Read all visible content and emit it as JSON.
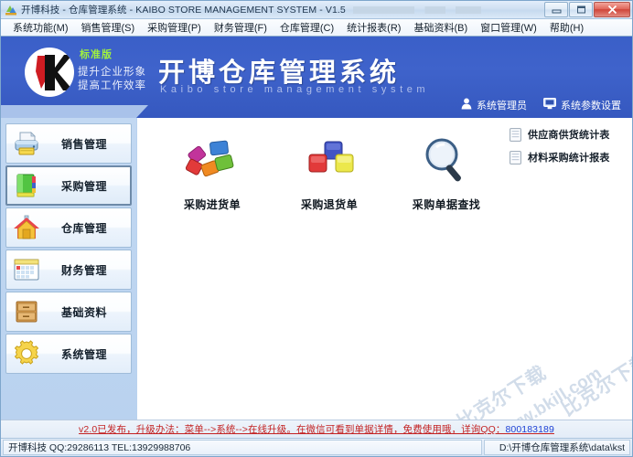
{
  "window": {
    "title": "开博科技 - 仓库管理系统 - KAIBO STORE MANAGEMENT SYSTEM - V1.5",
    "app_icon": "app-icon",
    "controls": {
      "minimize": "—",
      "maximize": "❐",
      "close": "✕"
    }
  },
  "menubar": {
    "items": [
      {
        "label": "系统功能(M)"
      },
      {
        "label": "销售管理(S)"
      },
      {
        "label": "采购管理(P)"
      },
      {
        "label": "财务管理(F)"
      },
      {
        "label": "仓库管理(C)"
      },
      {
        "label": "统计报表(R)"
      },
      {
        "label": "基础资料(B)"
      },
      {
        "label": "窗口管理(W)"
      },
      {
        "label": "帮助(H)"
      }
    ]
  },
  "banner": {
    "edition_badge": "标准版",
    "slogan_line1": "提升企业形象",
    "slogan_line2": "提高工作效率",
    "brand_cn": "开博仓库管理系统",
    "brand_en": "Kaibo store management system",
    "tools": [
      {
        "icon": "user-icon",
        "label": "系统管理员"
      },
      {
        "icon": "monitor-icon",
        "label": "系统参数设置"
      }
    ]
  },
  "sidebar": {
    "items": [
      {
        "label": "销售管理",
        "icon": "printer-icon",
        "selected": false
      },
      {
        "label": "采购管理",
        "icon": "book-icon",
        "selected": true
      },
      {
        "label": "仓库管理",
        "icon": "house-icon",
        "selected": false
      },
      {
        "label": "财务管理",
        "icon": "calendar-icon",
        "selected": false
      },
      {
        "label": "基础资料",
        "icon": "cabinet-icon",
        "selected": false
      },
      {
        "label": "系统管理",
        "icon": "gear-icon",
        "selected": false
      }
    ]
  },
  "content": {
    "tiles": [
      {
        "label": "采购进货单",
        "icon": "pinwheel-tiles-icon"
      },
      {
        "label": "采购退货单",
        "icon": "three-squares-icon"
      },
      {
        "label": "采购单据查找",
        "icon": "magnifier-icon"
      }
    ],
    "reports": [
      {
        "label": "供应商供货统计表",
        "icon": "document-icon"
      },
      {
        "label": "材料采购统计报表",
        "icon": "document-icon"
      }
    ],
    "watermarks": {
      "w1": "比克尔下载",
      "w2": "www.bkill.com",
      "w3": "比克尔下载"
    }
  },
  "notice": {
    "text": "v2.0已发布，升级办法：菜单-->系统-->在线升级。在微信可看到单据详情，免费使用哦，详询QQ：",
    "qq": "800183189"
  },
  "statusbar": {
    "left": "开博科技 QQ:29286113 TEL:13929988706",
    "right": "D:\\开博仓库管理系统\\data\\kst"
  },
  "colors": {
    "banner_blue": "#3a5fc8",
    "sidebar_blue": "#c2d8f2",
    "notice_red": "#c32222",
    "badge_green": "#9ff03f"
  }
}
